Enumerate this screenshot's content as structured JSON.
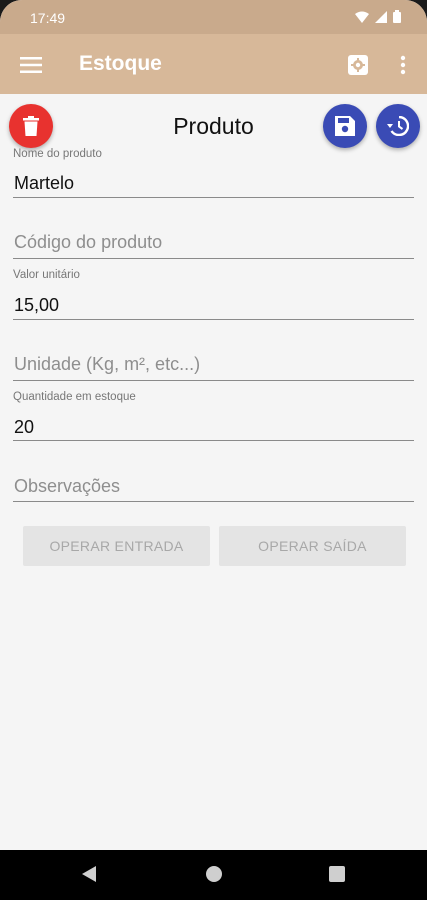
{
  "status_bar": {
    "time": "17:49"
  },
  "app_bar": {
    "title": "Estoque"
  },
  "screen": {
    "title": "Produto"
  },
  "fields": {
    "nome": {
      "label": "Nome do produto",
      "value": "Martelo"
    },
    "codigo": {
      "placeholder": "Código do produto"
    },
    "valor": {
      "label": "Valor unitário",
      "value": "15,00"
    },
    "unidade": {
      "placeholder": "Unidade (Kg, m², etc...)"
    },
    "quantidade": {
      "label": "Quantidade em estoque",
      "value": "20"
    },
    "observacoes": {
      "placeholder": "Observações"
    }
  },
  "actions": {
    "entrada": "OPERAR ENTRADA",
    "saida": "OPERAR SAÍDA"
  },
  "colors": {
    "app_bar": "#d7b899",
    "status_bar": "#c9aa8c",
    "delete": "#e8322f",
    "primary_fab": "#3a4bb5"
  },
  "icons": {
    "menu": "menu-icon",
    "settings": "settings-icon",
    "overflow": "more-vert-icon",
    "delete": "trash-icon",
    "save": "save-icon",
    "history": "history-icon"
  }
}
